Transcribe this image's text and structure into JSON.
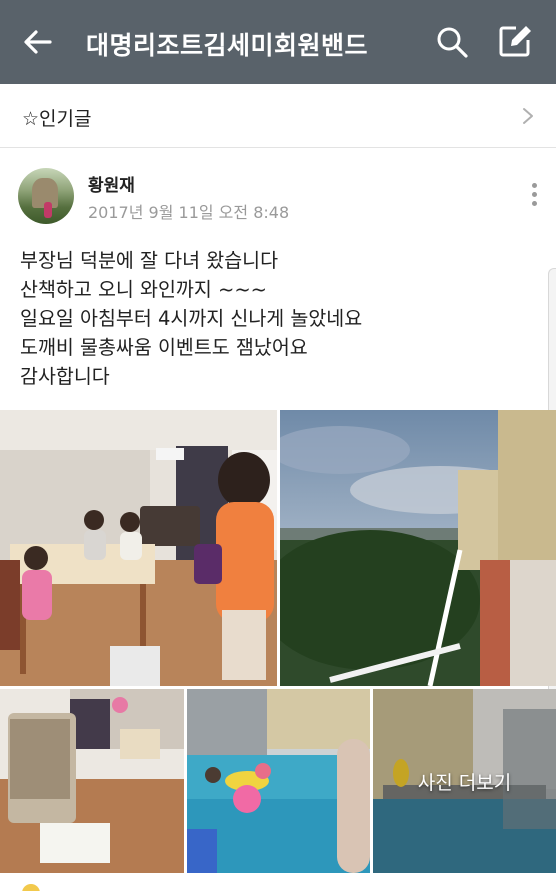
{
  "app_bar": {
    "title": "대명리조트김세미회원밴드",
    "back_icon": "arrow-left-icon",
    "search_icon": "search-icon",
    "compose_icon": "compose-icon",
    "background_color": "#59626a"
  },
  "popular": {
    "label": "☆인기글",
    "chevron_icon": "chevron-right-icon"
  },
  "post": {
    "author": "황원재",
    "date": "2017년 9월 11일 오전 8:48",
    "lines": [
      "부장님 덕분에 잘 다녀 왔습니다",
      "산책하고 오니 와인까지 ~~~",
      "일요일 아침부터 4시까지 신나게 놀았네요",
      "도깨비 물총싸움 이벤트도 잼났어요",
      "감사합니다"
    ],
    "photos": [
      {
        "name": "photo-room-family"
      },
      {
        "name": "photo-resort-view"
      },
      {
        "name": "photo-room-interior"
      },
      {
        "name": "photo-pool-kids"
      },
      {
        "name": "photo-pool-more"
      }
    ],
    "more_photos_label": "사진 더보기"
  }
}
